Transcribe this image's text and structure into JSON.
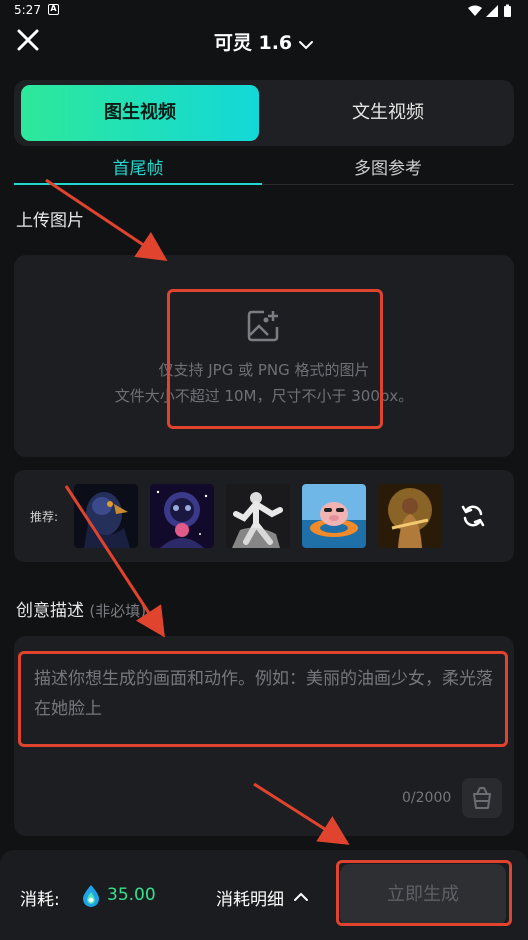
{
  "status_bar": {
    "time": "5:27",
    "notif_glyph": "A"
  },
  "header": {
    "title": "可灵 1.6"
  },
  "mode_switch": {
    "active": "图生视频",
    "inactive": "文生视频"
  },
  "sub_tabs": {
    "active": "首尾帧",
    "inactive": "多图参考"
  },
  "upload": {
    "section_title": "上传图片",
    "hint_line1": "仅支持 JPG 或 PNG 格式的图片",
    "hint_line2": "文件大小不超过 10M，尺寸不小于 300px。"
  },
  "recommend": {
    "label": "推荐:",
    "thumbnails": [
      {
        "name": "eagle"
      },
      {
        "name": "astronaut"
      },
      {
        "name": "dancer"
      },
      {
        "name": "pig-float"
      },
      {
        "name": "goddess"
      }
    ]
  },
  "description": {
    "title": "创意描述",
    "optional": "(非必填)",
    "placeholder": "描述你想生成的画面和动作。例如：美丽的油画少女，柔光落在她脸上",
    "count": "0/2000"
  },
  "bottom": {
    "cost_label": "消耗:",
    "cost_value": "35.00",
    "detail_label": "消耗明细",
    "generate_label": "立即生成"
  },
  "colors": {
    "accent": "#22d7d0",
    "gradient_start": "#2ee89a",
    "gradient_end": "#13d8d8",
    "annotation": "#e0442e",
    "cost": "#36e08e"
  }
}
